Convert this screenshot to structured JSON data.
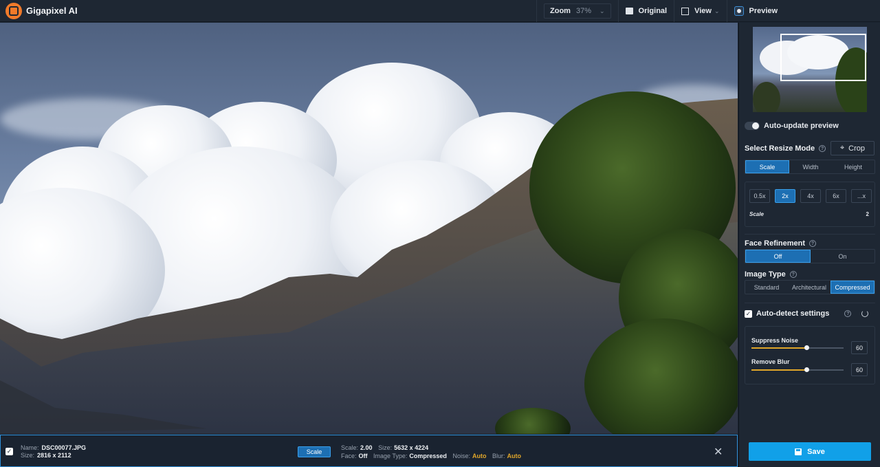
{
  "app": {
    "title": "Gigapixel AI",
    "logo": "gigapixel-logo"
  },
  "topbar": {
    "zoom_label": "Zoom",
    "zoom_value": "37%",
    "original_label": "Original",
    "view_label": "View",
    "preview_label": "Preview"
  },
  "panel": {
    "auto_update_label": "Auto-update preview",
    "resize_mode_label": "Select Resize Mode",
    "crop_label": "Crop",
    "resize_tabs": [
      "Scale",
      "Width",
      "Height"
    ],
    "resize_active": "Scale",
    "scale_options": [
      "0.5x",
      "2x",
      "4x",
      "6x",
      "...x"
    ],
    "scale_active": "2x",
    "scale_label": "Scale",
    "scale_value": "2",
    "face_label": "Face Refinement",
    "face_options": [
      "Off",
      "On"
    ],
    "face_active": "Off",
    "image_type_label": "Image Type",
    "image_type_options": [
      "Standard",
      "Architectural",
      "Compressed"
    ],
    "image_type_active": "Compressed",
    "auto_detect_label": "Auto-detect settings",
    "suppress_noise_label": "Suppress Noise",
    "suppress_noise_value": "60",
    "remove_blur_label": "Remove Blur",
    "remove_blur_value": "60",
    "save_label": "Save"
  },
  "bottom": {
    "name_label": "Name:",
    "name_value": "DSC00077.JPG",
    "size_label": "Size:",
    "size_value": "2816 x 2112",
    "scale_button": "Scale",
    "scale_label": "Scale:",
    "scale_value": "2.00",
    "out_size_label": "Size:",
    "out_size_value": "5632 x 4224",
    "face_label": "Face:",
    "face_value": "Off",
    "type_label": "Image Type:",
    "type_value": "Compressed",
    "noise_label": "Noise:",
    "noise_value": "Auto",
    "blur_label": "Blur:",
    "blur_value": "Auto"
  },
  "colors": {
    "accent": "#1d6fb3",
    "save": "#11a0e8",
    "auto": "#e0a62a",
    "brand": "#f07a2a"
  }
}
